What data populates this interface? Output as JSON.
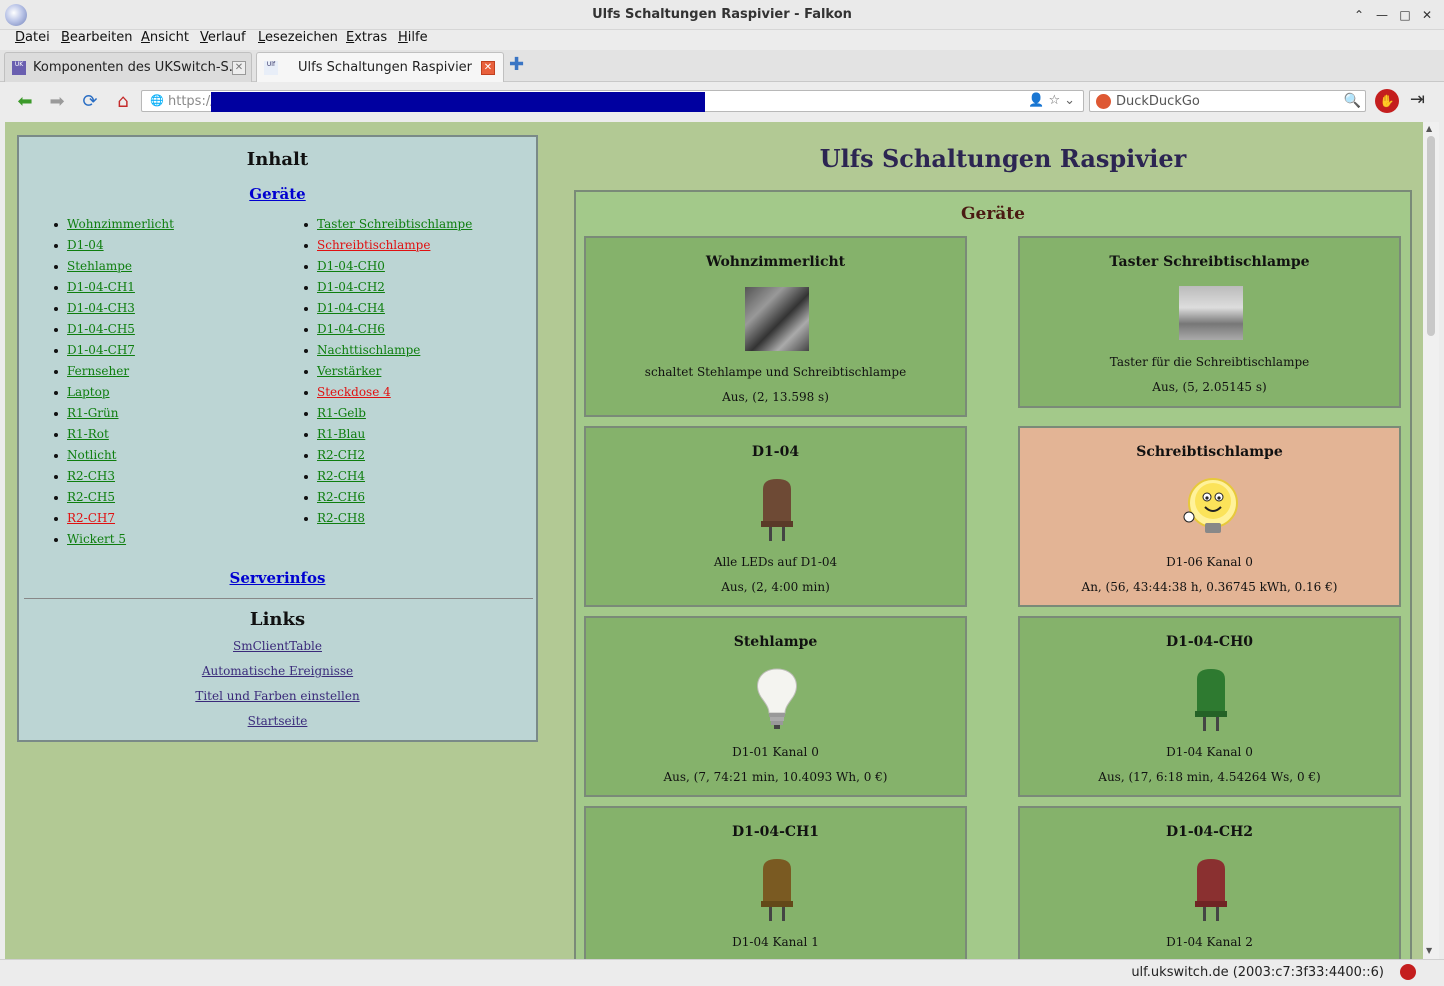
{
  "window": {
    "title": "Ulfs Schaltungen Raspivier - Falkon"
  },
  "menu": [
    "Datei",
    "Bearbeiten",
    "Ansicht",
    "Verlauf",
    "Lesezeichen",
    "Extras",
    "Hilfe"
  ],
  "tabs": [
    {
      "label": "Komponenten des UKSwitch-S...",
      "active": false
    },
    {
      "label": "Ulfs Schaltungen Raspivier",
      "active": true
    }
  ],
  "url": {
    "scheme": "https://"
  },
  "search": {
    "engine": "DuckDuckGo"
  },
  "status": {
    "text": "ulf.ukswitch.de (2003:c7:3f33:4400::6)"
  },
  "toc": {
    "title": "Inhalt",
    "devices_link": "Geräte",
    "col1": [
      {
        "label": "Wohnzimmerlicht",
        "on": false
      },
      {
        "label": "D1-04",
        "on": false
      },
      {
        "label": "Stehlampe",
        "on": false
      },
      {
        "label": "D1-04-CH1",
        "on": false
      },
      {
        "label": "D1-04-CH3",
        "on": false
      },
      {
        "label": "D1-04-CH5",
        "on": false
      },
      {
        "label": "D1-04-CH7",
        "on": false
      },
      {
        "label": "Fernseher",
        "on": false
      },
      {
        "label": "Laptop",
        "on": false
      },
      {
        "label": "R1-Grün",
        "on": false
      },
      {
        "label": "R1-Rot",
        "on": false
      },
      {
        "label": "Notlicht",
        "on": false
      },
      {
        "label": "R2-CH3",
        "on": false
      },
      {
        "label": "R2-CH5",
        "on": false
      },
      {
        "label": "R2-CH7",
        "on": true
      },
      {
        "label": "Wickert 5",
        "on": false
      }
    ],
    "col2": [
      {
        "label": "Taster Schreibtischlampe",
        "on": false
      },
      {
        "label": "Schreibtischlampe",
        "on": true
      },
      {
        "label": "D1-04-CH0",
        "on": false
      },
      {
        "label": "D1-04-CH2",
        "on": false
      },
      {
        "label": "D1-04-CH4",
        "on": false
      },
      {
        "label": "D1-04-CH6",
        "on": false
      },
      {
        "label": "Nachttischlampe",
        "on": false
      },
      {
        "label": "Verstärker",
        "on": false
      },
      {
        "label": "Steckdose 4",
        "on": true
      },
      {
        "label": "R1-Gelb",
        "on": false
      },
      {
        "label": "R1-Blau",
        "on": false
      },
      {
        "label": "R2-CH2",
        "on": false
      },
      {
        "label": "R2-CH4",
        "on": false
      },
      {
        "label": "R2-CH6",
        "on": false
      },
      {
        "label": "R2-CH8",
        "on": false
      }
    ],
    "serverinfo_link": "Serverinfos",
    "links_title": "Links",
    "links": [
      "SmClientTable",
      "Automatische Ereignisse",
      "Titel und Farben einstellen",
      "Startseite"
    ]
  },
  "main": {
    "title": "Ulfs Schaltungen Raspivier",
    "devices_title": "Geräte",
    "cards": [
      {
        "name": "Wohnzimmerlicht",
        "image": "flowers-photo",
        "desc": "schaltet Stehlampe und Schreibtischlampe",
        "state": "Aus, (2, 13.598 s)",
        "on": false
      },
      {
        "name": "Taster Schreibtischlampe",
        "image": "vintage-car-photo",
        "desc": "Taster für die Schreibtischlampe",
        "state": "Aus, (5, 2.05145 s)",
        "on": false
      },
      {
        "name": "D1-04",
        "image": "led-icon",
        "led_color": "#6e4a35",
        "desc": "Alle LEDs auf D1-04",
        "state": "Aus, (2, 4:00 min)",
        "on": false
      },
      {
        "name": "Schreibtischlampe",
        "image": "cartoon-bulb-icon",
        "desc": "D1-06 Kanal 0",
        "state": "An, (56, 43:44:38 h, 0.36745 kWh, 0.16 €)",
        "on": true
      },
      {
        "name": "Stehlampe",
        "image": "lightbulb-icon",
        "desc": "D1-01 Kanal 0",
        "state": "Aus, (7, 74:21 min, 10.4093 Wh, 0 €)",
        "on": false
      },
      {
        "name": "D1-04-CH0",
        "image": "led-icon",
        "led_color": "#2e7a30",
        "desc": "D1-04 Kanal 0",
        "state": "Aus, (17, 6:18 min, 4.54264 Ws, 0 €)",
        "on": false
      },
      {
        "name": "D1-04-CH1",
        "image": "led-icon",
        "led_color": "#7a5a22",
        "desc": "D1-04 Kanal 1",
        "state": "",
        "on": false
      },
      {
        "name": "D1-04-CH2",
        "image": "led-icon",
        "led_color": "#8a3030",
        "desc": "D1-04 Kanal 2",
        "state": "",
        "on": false
      }
    ]
  }
}
